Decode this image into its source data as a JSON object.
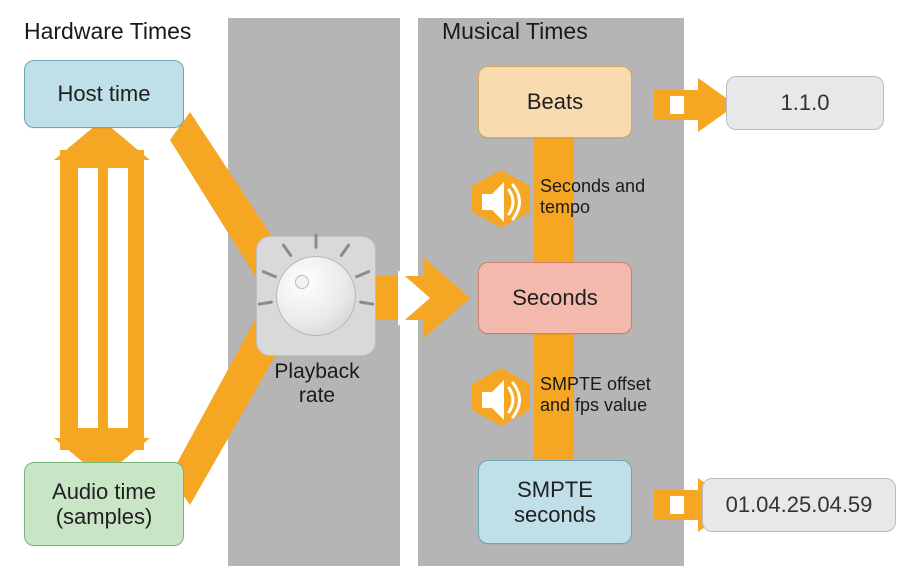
{
  "headings": {
    "hardware": "Hardware Times",
    "musical": "Musical Times"
  },
  "nodes": {
    "host": "Host time",
    "audio": "Audio time\n(samples)",
    "beats": "Beats",
    "seconds": "Seconds",
    "smpte": "SMPTE\nseconds"
  },
  "playback": {
    "label": "Playback\nrate"
  },
  "conversions": {
    "beats_seconds": "Seconds and\ntempo",
    "seconds_smpte": "SMPTE offset\nand fps value"
  },
  "values": {
    "beats": "1.1.0",
    "smpte": "01.04.25.04.59"
  },
  "colors": {
    "orange": "#f5a623",
    "host_fill": "#bfe0e8",
    "host_stroke": "#6aa6b5",
    "audio_fill": "#c8e6c6",
    "audio_stroke": "#7bb57a",
    "beats_fill": "#f8dcb0",
    "beats_stroke": "#d6a85f",
    "seconds_fill": "#f4b9ad",
    "seconds_stroke": "#d07f6d",
    "smpte_fill": "#bfe0e8",
    "smpte_stroke": "#6aa6b5"
  }
}
